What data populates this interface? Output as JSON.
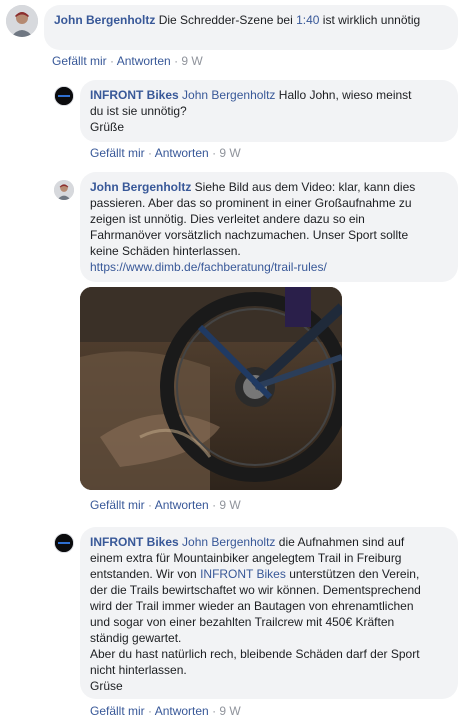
{
  "comments": [
    {
      "author": "John Bergenholtz",
      "text_before": "Die Schredder-Szene bei ",
      "timestamp_link": "1:40",
      "text_after": " ist wirklich unnötig",
      "actions": {
        "like": "Gefällt mir",
        "reply": "Antworten",
        "age": "9 W"
      }
    },
    {
      "author": "INFRONT Bikes",
      "mention": "John Bergenholtz",
      "line1": " Hallo John, wieso meinst",
      "line2": "du ist sie unnötig?",
      "line3": "Grüße",
      "actions": {
        "like": "Gefällt mir",
        "reply": "Antworten",
        "age": "9 W"
      }
    },
    {
      "author": "John Bergenholtz",
      "line1": " Siehe Bild aus dem Video: klar, kann dies",
      "line2": "passieren. Aber das so prominent in einer Großaufnahme zu",
      "line3": "zeigen ist unnötig. Dies verleitet andere dazu so ein",
      "line4": "Fahrmanöver vorsätzlich nachzumachen. Unser Sport sollte",
      "line5": "keine Schäden hinterlassen.",
      "url": "https://www.dimb.de/fachberatung/trail-rules/",
      "actions": {
        "like": "Gefällt mir",
        "reply": "Antworten",
        "age": "9 W"
      }
    },
    {
      "author": "INFRONT Bikes",
      "mention": "John Bergenholtz",
      "line1": " die Aufnahmen sind auf",
      "line2": "einem extra für Mountainbiker angelegtem Trail in Freiburg",
      "line3a": "entstanden. Wir von ",
      "line3_mention": "INFRONT Bikes",
      "line3b": " unterstützen den Verein,",
      "line4": "der die Trails bewirtschaftet wo wir können. Dementsprechend",
      "line5": "wird der Trail immer wieder an Bautagen von ehrenamtlichen",
      "line6": "und sogar von einer bezahlten Trailcrew mit 450€ Kräften",
      "line7": "ständig gewartet.",
      "line8": "Aber du hast natürlich rech, bleibende Schäden darf der Sport",
      "line9": "nicht hinterlassen.",
      "line10": "Grüse",
      "actions": {
        "like": "Gefällt mir",
        "reply": "Antworten",
        "age": "9 W"
      }
    }
  ],
  "separator": "·",
  "colors": {
    "link": "#385898",
    "bubble": "#f2f3f5",
    "meta": "#90949c"
  },
  "icons": {
    "user_avatar": "user-avatar-icon",
    "brand_avatar": "infront-logo-icon"
  }
}
